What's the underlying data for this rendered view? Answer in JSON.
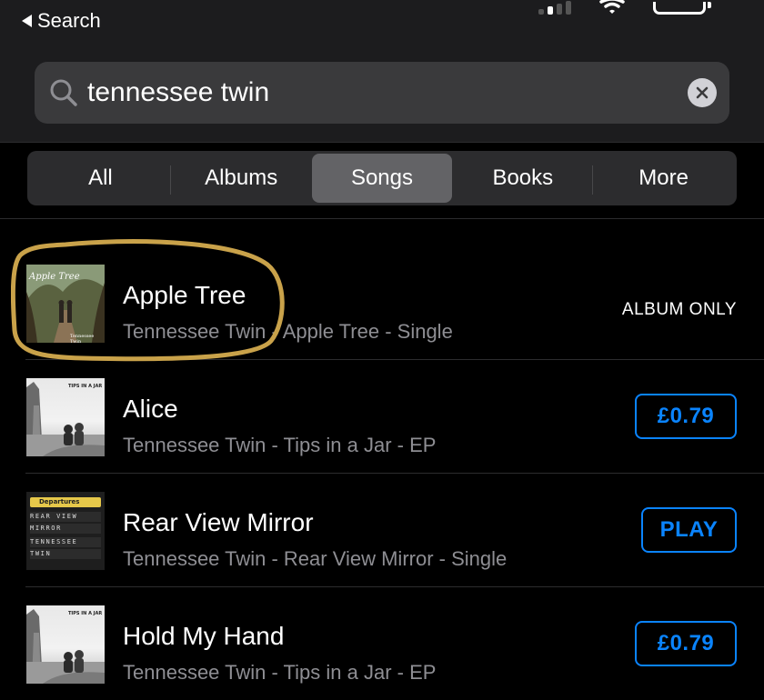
{
  "status_bar": {
    "back_label": "Search"
  },
  "search": {
    "value": "tennessee twin",
    "placeholder": ""
  },
  "tabs": [
    {
      "label": "All",
      "active": false
    },
    {
      "label": "Albums",
      "active": false
    },
    {
      "label": "Songs",
      "active": true
    },
    {
      "label": "Books",
      "active": false
    },
    {
      "label": "More",
      "active": false
    }
  ],
  "songs": [
    {
      "title": "Apple Tree",
      "subtitle": "Tennessee Twin - Apple Tree - Single",
      "action": "ALBUM ONLY",
      "artwork_text": "Apple Tree",
      "artwork_sub": "Tennessee Twin"
    },
    {
      "title": "Alice",
      "subtitle": "Tennessee Twin - Tips in a Jar - EP",
      "action": "£0.79",
      "artwork_text": "TIPS IN A JAR"
    },
    {
      "title": "Rear View Mirror",
      "subtitle": "Tennessee Twin - Rear View Mirror - Single",
      "action": "PLAY",
      "artwork_text": "Departures",
      "artwork_board": [
        "REAR VIEW",
        "MIRROR",
        "TENNESSEE",
        "TWIN"
      ]
    },
    {
      "title": "Hold My Hand",
      "subtitle": "Tennessee Twin - Tips in a Jar - EP",
      "action": "£0.79",
      "artwork_text": "TIPS IN A JAR"
    }
  ],
  "colors": {
    "accent": "#0a84ff",
    "highlight_ring": "#c9a24a",
    "secondary_text": "#8e8e93"
  }
}
